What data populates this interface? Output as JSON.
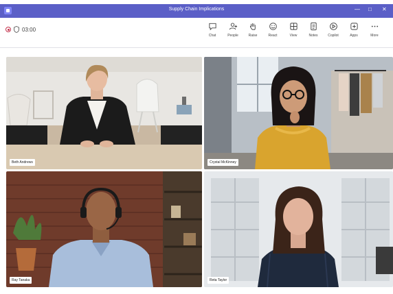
{
  "window": {
    "title": "Supply Chain Implications"
  },
  "call": {
    "timer": "03:00"
  },
  "toolbar": {
    "buttons": [
      {
        "label": "Chat",
        "icon": "chat-icon"
      },
      {
        "label": "People",
        "icon": "people-icon"
      },
      {
        "label": "Raise",
        "icon": "raise-hand-icon"
      },
      {
        "label": "React",
        "icon": "react-icon"
      },
      {
        "label": "View",
        "icon": "view-icon"
      },
      {
        "label": "Notes",
        "icon": "notes-icon"
      },
      {
        "label": "Copilot",
        "icon": "copilot-icon"
      },
      {
        "label": "Apps",
        "icon": "apps-icon"
      },
      {
        "label": "More",
        "icon": "more-icon"
      }
    ]
  },
  "participants": [
    {
      "name": "Beth Andrews"
    },
    {
      "name": "Crystal McKinney"
    },
    {
      "name": "Ray Tanaka"
    },
    {
      "name": "Reta Taylor"
    }
  ],
  "colors": {
    "brand": "#5b5fc7",
    "recording": "#c4314b"
  }
}
